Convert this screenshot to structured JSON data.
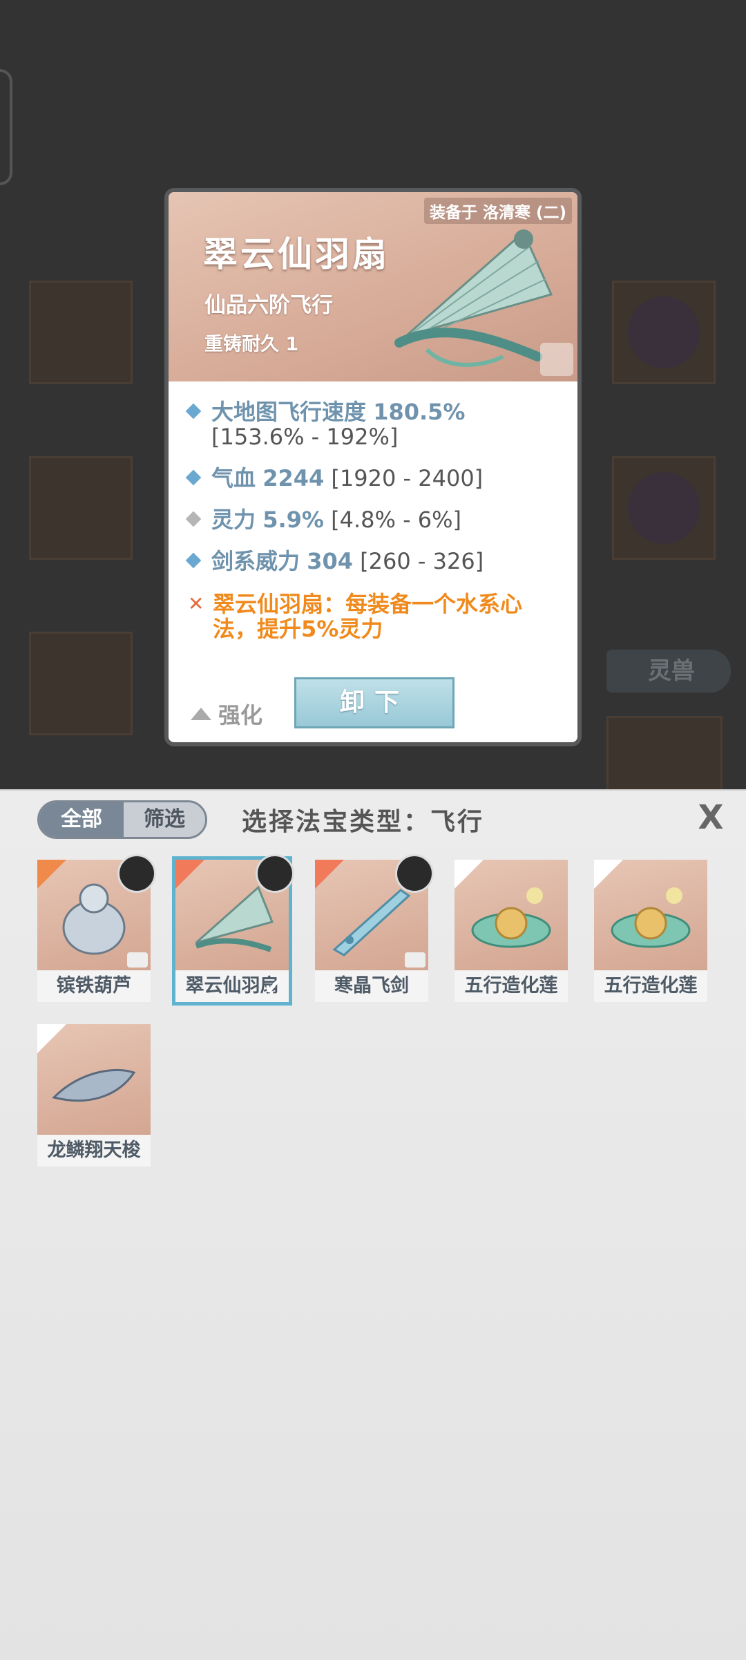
{
  "background": {
    "side_tab_label": "灵兽"
  },
  "detail": {
    "equipped_on": "装备于 洛清寒 (二)",
    "name": "翠云仙羽扇",
    "grade": "仙品六阶飞行",
    "durability": "重铸耐久 1",
    "stats": [
      {
        "name": "大地图飞行速度",
        "value": "180.5%",
        "range": "[153.6% - 192%]"
      },
      {
        "name": "气血",
        "value": "2244",
        "range": "[1920 - 2400]"
      },
      {
        "name": "灵力",
        "value": "5.9%",
        "range": "[4.8% - 6%]"
      },
      {
        "name": "剑系威力",
        "value": "304",
        "range": "[260 - 326]"
      }
    ],
    "effect": "翠云仙羽扇：每装备一个水系心法，提升5%灵力",
    "strengthen_label": "强化",
    "unequip_label": "卸下"
  },
  "panel": {
    "tab_all": "全部",
    "tab_filter": "筛选",
    "title": "选择法宝类型：飞行",
    "close_label": "X",
    "items": [
      {
        "label": "镔铁葫芦"
      },
      {
        "label": "翠云仙羽扇"
      },
      {
        "label": "寒晶飞剑"
      },
      {
        "label": "五行造化莲"
      },
      {
        "label": "五行造化莲"
      },
      {
        "label": "龙鳞翔天梭"
      }
    ]
  },
  "colors": {
    "accent": "#5fb3cf",
    "stat_value": "#6f93ad",
    "effect_text": "#f08a1c"
  }
}
